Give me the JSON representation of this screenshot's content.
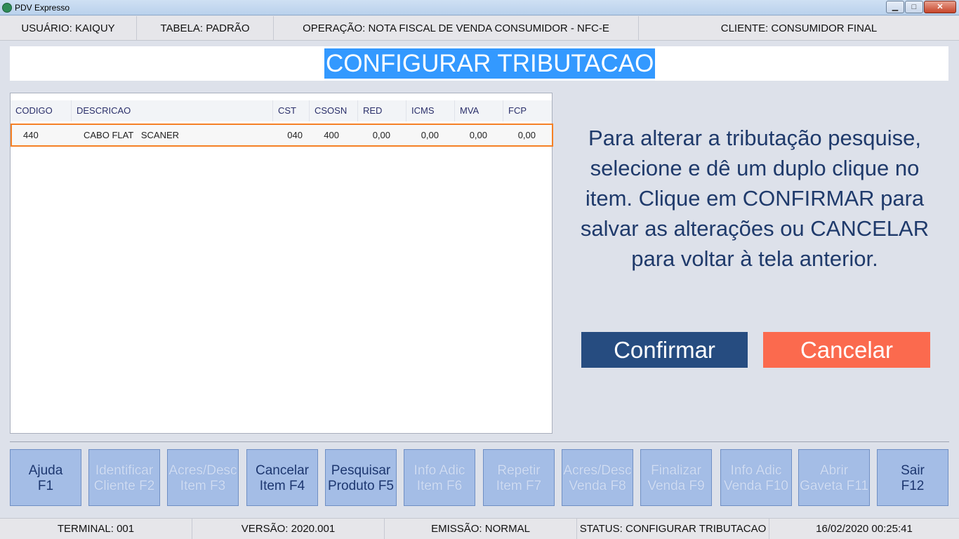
{
  "window": {
    "title": "PDV Expresso"
  },
  "infobar": {
    "usuario": "USUÁRIO: KAIQUY",
    "tabela": "TABELA: PADRÃO",
    "operacao": "OPERAÇÃO: NOTA FISCAL DE VENDA CONSUMIDOR - NFC-E",
    "cliente": "CLIENTE: CONSUMIDOR FINAL"
  },
  "header": {
    "title": "CONFIGURAR TRIBUTACAO"
  },
  "grid": {
    "columns": [
      "CODIGO",
      "DESCRICAO",
      "CST",
      "CSOSN",
      "RED",
      "ICMS",
      "MVA",
      "FCP"
    ],
    "rows": [
      {
        "codigo": "440",
        "descricao": "CABO FLAT   SCANER",
        "cst": "040",
        "csosn": "400",
        "red": "0,00",
        "icms": "0,00",
        "mva": "0,00",
        "fcp": "0,00"
      }
    ]
  },
  "instruction": "Para alterar a tributação pesquise, selecione e dê um duplo clique no item. Clique em CONFIRMAR para salvar as alterações ou CANCELAR para voltar à tela anterior.",
  "actions": {
    "confirm": "Confirmar",
    "cancel": "Cancelar"
  },
  "fkeys": [
    {
      "line1": "Ajuda",
      "line2": "F1",
      "enabled": true
    },
    {
      "line1": "Identificar",
      "line2": "Cliente F2",
      "enabled": false
    },
    {
      "line1": "Acres/Desc",
      "line2": "Item F3",
      "enabled": false
    },
    {
      "line1": "Cancelar",
      "line2": "Item F4",
      "enabled": true
    },
    {
      "line1": "Pesquisar",
      "line2": "Produto F5",
      "enabled": true
    },
    {
      "line1": "Info Adic",
      "line2": "Item F6",
      "enabled": false
    },
    {
      "line1": "Repetir",
      "line2": "Item F7",
      "enabled": false
    },
    {
      "line1": "Acres/Desc",
      "line2": "Venda F8",
      "enabled": false
    },
    {
      "line1": "Finalizar",
      "line2": "Venda F9",
      "enabled": false
    },
    {
      "line1": "Info Adic",
      "line2": "Venda F10",
      "enabled": false
    },
    {
      "line1": "Abrir",
      "line2": "Gaveta F11",
      "enabled": false
    },
    {
      "line1": "Sair",
      "line2": "F12",
      "enabled": true
    }
  ],
  "statusbar": {
    "terminal": "TERMINAL: 001",
    "versao": "VERSÃO: 2020.001",
    "emissao": "EMISSÃO: NORMAL",
    "status": "STATUS: CONFIGURAR TRIBUTACAO",
    "datetime": "16/02/2020 00:25:41"
  }
}
